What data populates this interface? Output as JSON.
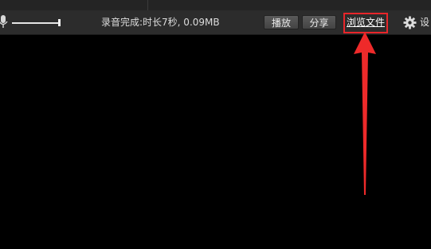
{
  "toolbar": {
    "status": "录音完成:时长7秒, 0.09MB",
    "play_label": "播放",
    "share_label": "分享",
    "browse_label": "浏览文件",
    "settings_label": "设"
  },
  "icons": {
    "mic": "microphone-icon",
    "gear": "gear-icon"
  },
  "volume": {
    "level": 1.0
  },
  "colors": {
    "background": "#000000",
    "toolbar": "#2c2c2c",
    "highlight": "#e8262a",
    "arrow": "#ee2a2a"
  }
}
